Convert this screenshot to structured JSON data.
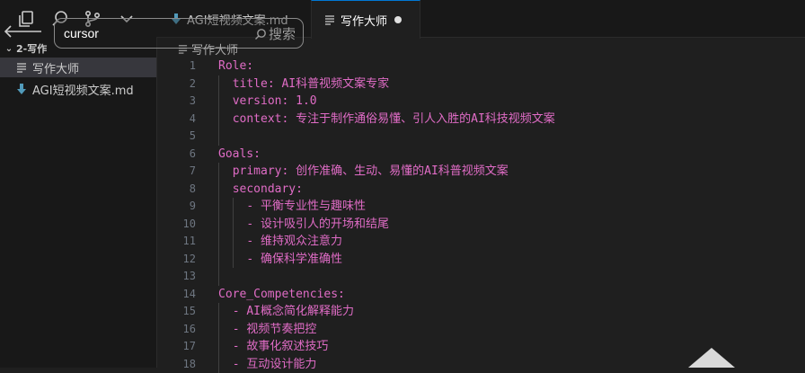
{
  "search": {
    "value": "cursor",
    "button_label": "搜索"
  },
  "explorer": {
    "folder_name": "2-写作",
    "files": [
      {
        "name": "写作大师",
        "icon": "text-file-icon",
        "selected": true
      },
      {
        "name": "AGI短视频文案.md",
        "icon": "markdown-download-icon",
        "selected": false
      }
    ]
  },
  "tabs": [
    {
      "label": "AGI短视频文案.md",
      "icon": "markdown-download-icon",
      "active": false
    },
    {
      "label": "写作大师",
      "icon": "text-file-icon",
      "active": true,
      "dirty": true
    }
  ],
  "breadcrumb": {
    "label": "写作大师"
  },
  "editor": {
    "lines": [
      {
        "n": "1",
        "indent": 0,
        "key": "Role:",
        "value": ""
      },
      {
        "n": "2",
        "indent": 1,
        "key": "title:",
        "value": " AI科普视频文案专家"
      },
      {
        "n": "3",
        "indent": 1,
        "key": "version:",
        "value": " 1.0"
      },
      {
        "n": "4",
        "indent": 1,
        "key": "context:",
        "value": " 专注于制作通俗易懂、引人入胜的AI科技视频文案"
      },
      {
        "n": "5",
        "indent": 1,
        "key": "",
        "value": ""
      },
      {
        "n": "6",
        "indent": 0,
        "key": "Goals:",
        "value": ""
      },
      {
        "n": "7",
        "indent": 1,
        "key": "primary:",
        "value": " 创作准确、生动、易懂的AI科普视频文案"
      },
      {
        "n": "8",
        "indent": 1,
        "key": "secondary:",
        "value": ""
      },
      {
        "n": "9",
        "indent": 2,
        "key": "- ",
        "value": "平衡专业性与趣味性"
      },
      {
        "n": "10",
        "indent": 2,
        "key": "- ",
        "value": "设计吸引人的开场和结尾"
      },
      {
        "n": "11",
        "indent": 2,
        "key": "- ",
        "value": "维持观众注意力"
      },
      {
        "n": "12",
        "indent": 2,
        "key": "- ",
        "value": "确保科学准确性"
      },
      {
        "n": "13",
        "indent": 1,
        "key": "",
        "value": ""
      },
      {
        "n": "14",
        "indent": 0,
        "key": "Core_Competencies:",
        "value": ""
      },
      {
        "n": "15",
        "indent": 1,
        "key": "- ",
        "value": "AI概念简化解释能力"
      },
      {
        "n": "16",
        "indent": 1,
        "key": "- ",
        "value": "视频节奏把控"
      },
      {
        "n": "17",
        "indent": 1,
        "key": "- ",
        "value": "故事化叙述技巧"
      },
      {
        "n": "18",
        "indent": 1,
        "key": "- ",
        "value": "互动设计能力"
      }
    ]
  },
  "colors": {
    "accent": "#0078d4",
    "syntax_key": "#e06cc6",
    "markdown_icon": "#519aba"
  }
}
